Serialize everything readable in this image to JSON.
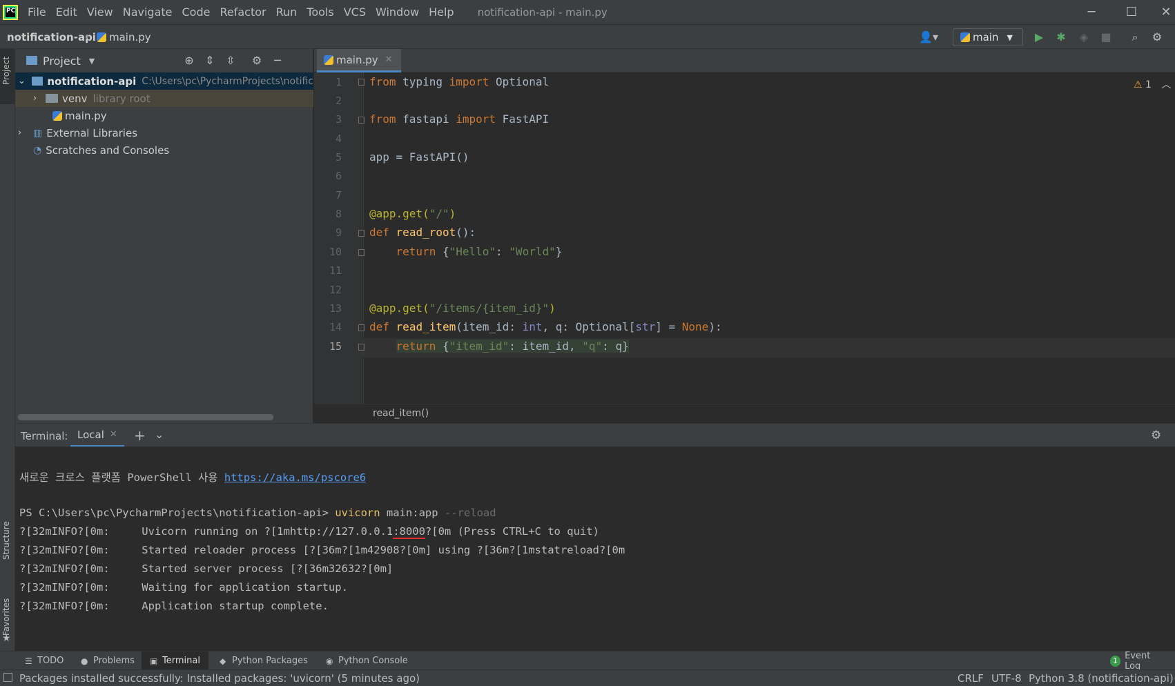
{
  "titlebar": {
    "menu": [
      "File",
      "Edit",
      "View",
      "Navigate",
      "Code",
      "Refactor",
      "Run",
      "Tools",
      "VCS",
      "Window",
      "Help"
    ],
    "window_title": "notification-api - main.py"
  },
  "navbar": {
    "project": "notification-api",
    "file": "main.py",
    "run_config": "main"
  },
  "left_stripe": {
    "project": "Project",
    "structure": "Structure",
    "favorites": "Favorites"
  },
  "project_panel": {
    "title": "Project",
    "tree": [
      {
        "label": "notification-api",
        "path": "C:\\Users\\pc\\PycharmProjects\\notific"
      },
      {
        "label": "venv",
        "note": "library root"
      },
      {
        "label": "main.py"
      },
      {
        "label": "External Libraries"
      },
      {
        "label": "Scratches and Consoles"
      }
    ]
  },
  "editor": {
    "tab": "main.py",
    "warning_count": "1",
    "line_numbers": [
      "1",
      "2",
      "3",
      "4",
      "5",
      "6",
      "7",
      "8",
      "9",
      "10",
      "11",
      "12",
      "13",
      "14",
      "15"
    ],
    "breadcrumb": "read_item()"
  },
  "terminal": {
    "label": "Terminal:",
    "tab": "Local",
    "lines": {
      "ps_intro": "새로운 크로스 플랫폼 PowerShell 사용 ",
      "ps_link": "https://aka.ms/pscore6",
      "prompt": "PS C:\\Users\\pc\\PycharmProjects\\notification-api> ",
      "cmd": "uvicorn",
      "cmd_arg": " main:app ",
      "cmd_flag": "--reload",
      "l1a": "?[32mINFO?[0m:     Uvicorn running on ?[1mhttp://127.0.0.1",
      "l1port": ":8000",
      "l1b": "?[0m (Press CTRL+C to quit)",
      "l2": "?[32mINFO?[0m:     Started reloader process [?[36m?[1m42908?[0m] using ?[36m?[1mstatreload?[0m",
      "l3": "?[32mINFO?[0m:     Started server process [?[36m32632?[0m]",
      "l4": "?[32mINFO?[0m:     Waiting for application startup.",
      "l5": "?[32mINFO?[0m:     Application startup complete."
    }
  },
  "bottom_tools": [
    "TODO",
    "Problems",
    "Terminal",
    "Python Packages",
    "Python Console"
  ],
  "event_log": "Event Log",
  "event_count": "1",
  "status": {
    "message": "Packages installed successfully: Installed packages: 'uvicorn' (5 minutes ago)",
    "line_sep": "CRLF",
    "encoding": "UTF-8",
    "interpreter": "Python 3.8 (notification-api)"
  }
}
